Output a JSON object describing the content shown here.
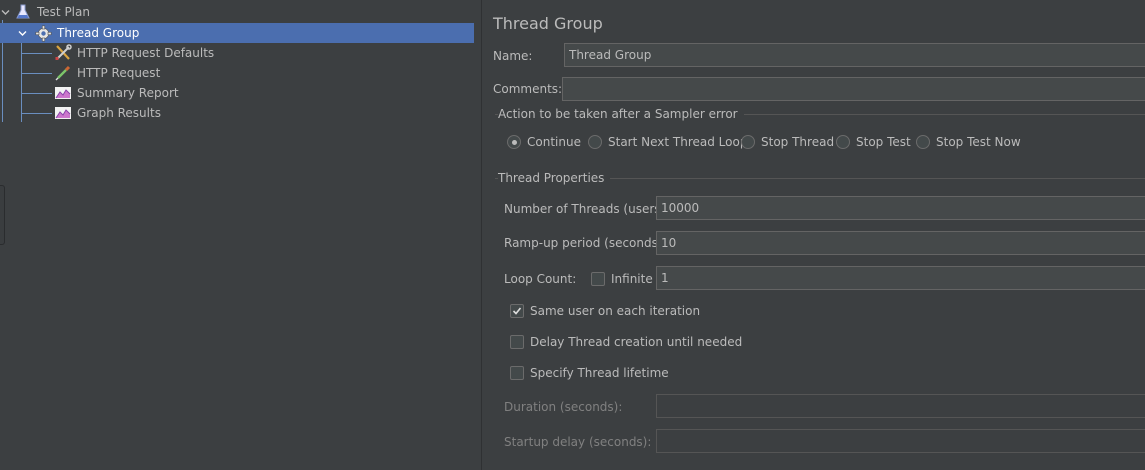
{
  "tree": {
    "items": [
      {
        "label": "Test Plan",
        "icon": "test-plan-flask-icon",
        "expanded": true
      },
      {
        "label": "Thread Group",
        "icon": "gear-icon",
        "expanded": true,
        "selected": true
      },
      {
        "label": "HTTP Request Defaults",
        "icon": "wrench-screwdriver-icon"
      },
      {
        "label": "HTTP Request",
        "icon": "pipette-icon"
      },
      {
        "label": "Summary Report",
        "icon": "chart-report-icon"
      },
      {
        "label": "Graph Results",
        "icon": "chart-report-icon"
      }
    ]
  },
  "panel": {
    "title": "Thread Group",
    "name_label": "Name:",
    "name_value": "Thread Group",
    "comments_label": "Comments:",
    "comments_value": ""
  },
  "sampler_error": {
    "title": "Action to be taken after a Sampler error",
    "options": [
      "Continue",
      "Start Next Thread Loop",
      "Stop Thread",
      "Stop Test",
      "Stop Test Now"
    ],
    "selected": "Continue"
  },
  "thread_properties": {
    "title": "Thread Properties",
    "threads_label": "Number of Threads (users):",
    "threads_value": "10000",
    "rampup_label": "Ramp-up period (seconds):",
    "rampup_value": "10",
    "loop_label": "Loop Count:",
    "infinite_label": "Infinite",
    "infinite_checked": false,
    "loop_value": "1",
    "same_user_label": "Same user on each iteration",
    "same_user_checked": true,
    "delay_label": "Delay Thread creation until needed",
    "delay_checked": false,
    "lifetime_label": "Specify Thread lifetime",
    "lifetime_checked": false,
    "duration_label": "Duration (seconds):",
    "duration_value": "",
    "startup_label": "Startup delay (seconds):",
    "startup_value": ""
  },
  "colors": {
    "background": "#3c3f41",
    "selection": "#4b6eaf",
    "text": "#bbbbbb",
    "input_bg": "#45494a"
  }
}
